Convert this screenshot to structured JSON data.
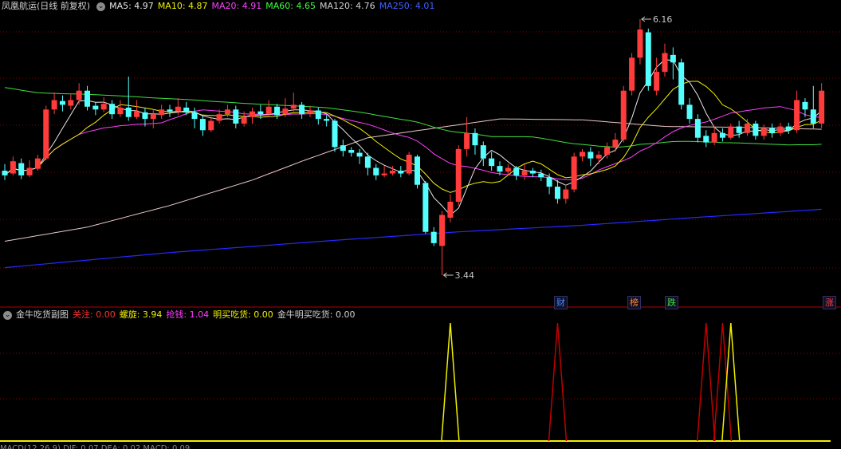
{
  "main_legend": {
    "title": "凤凰航运(日线 前复权)",
    "items": [
      {
        "label": "MA5: 4.97",
        "color": "#e8e8e8"
      },
      {
        "label": "MA10: 4.87",
        "color": "#f0f000"
      },
      {
        "label": "MA20: 4.91",
        "color": "#ff40ff"
      },
      {
        "label": "MA60: 4.65",
        "color": "#40ff40"
      },
      {
        "label": "MA120: 4.76",
        "color": "#d0d0d0"
      },
      {
        "label": "MA250: 4.01",
        "color": "#4060ff"
      }
    ]
  },
  "sub_legend": {
    "title": "金牛吃货副图",
    "items": [
      {
        "label": "关注: 0.00",
        "color": "#ff3030"
      },
      {
        "label": "螺旋: 3.94",
        "color": "#f0f000"
      },
      {
        "label": "抢钱: 1.04",
        "color": "#ff40ff"
      },
      {
        "label": "明买吃货: 0.00",
        "color": "#f0f000"
      },
      {
        "label": "金牛明买吃货: 0.00",
        "color": "#d0d0d0"
      }
    ]
  },
  "annotations": {
    "high": "6.16",
    "low": "3.44"
  },
  "signals": [
    {
      "label": "财",
      "color": "#4a8cff"
    },
    {
      "label": "榜",
      "color": "#ff8a30"
    },
    {
      "label": "跌",
      "color": "#40e040"
    },
    {
      "label": "涨",
      "color": "#ff4040"
    }
  ],
  "colors": {
    "up": "#ff3b3b",
    "down": "#54ffff",
    "grid": "#8b0000",
    "ma5": "#e8e8e8",
    "ma10": "#f0f000",
    "ma20": "#ff40ff",
    "ma60": "#40e040",
    "ma120": "#e8c8c8",
    "ma250": "#2828ff"
  },
  "bottom_strip": "MACD(12,26,9) DIF: 0.07 DEA: 0.02 MACD: 0.09",
  "chart_data": {
    "type": "candlestick",
    "symbol": "凤凰航运",
    "period": "日线 前复权",
    "price_range": [
      3.3,
      6.3
    ],
    "candles": [
      [
        4.55,
        4.5,
        4.62,
        4.45
      ],
      [
        4.52,
        4.65,
        4.7,
        4.5
      ],
      [
        4.63,
        4.5,
        4.68,
        4.46
      ],
      [
        4.5,
        4.58,
        4.66,
        4.48
      ],
      [
        4.57,
        4.68,
        4.72,
        4.55
      ],
      [
        4.68,
        5.2,
        5.24,
        4.66
      ],
      [
        5.2,
        5.3,
        5.38,
        5.15
      ],
      [
        5.29,
        5.25,
        5.35,
        5.18
      ],
      [
        5.24,
        5.3,
        5.36,
        5.2
      ],
      [
        5.3,
        5.4,
        5.48,
        5.25
      ],
      [
        5.4,
        5.23,
        5.45,
        5.19
      ],
      [
        5.24,
        5.2,
        5.28,
        5.14
      ],
      [
        5.2,
        5.26,
        5.33,
        5.17
      ],
      [
        5.26,
        5.15,
        5.3,
        5.1
      ],
      [
        5.15,
        5.22,
        5.3,
        5.12
      ],
      [
        5.22,
        5.12,
        5.55,
        5.08
      ],
      [
        5.12,
        5.18,
        5.3,
        5.1
      ],
      [
        5.17,
        5.1,
        5.22,
        5.02
      ],
      [
        5.1,
        5.15,
        5.2,
        5.0
      ],
      [
        5.14,
        5.2,
        5.25,
        5.1
      ],
      [
        5.2,
        5.18,
        5.25,
        5.12
      ],
      [
        5.18,
        5.23,
        5.32,
        5.14
      ],
      [
        5.22,
        5.17,
        5.28,
        5.14
      ],
      [
        5.17,
        5.1,
        5.22,
        5.0
      ],
      [
        5.1,
        4.98,
        5.14,
        4.92
      ],
      [
        4.98,
        5.08,
        5.12,
        4.96
      ],
      [
        5.08,
        5.15,
        5.2,
        5.05
      ],
      [
        5.15,
        5.2,
        5.25,
        5.12
      ],
      [
        5.2,
        5.05,
        5.24,
        5.0
      ],
      [
        5.05,
        5.12,
        5.18,
        5.02
      ],
      [
        5.12,
        5.18,
        5.22,
        5.05
      ],
      [
        5.18,
        5.15,
        5.25,
        5.1
      ],
      [
        5.15,
        5.23,
        5.3,
        5.12
      ],
      [
        5.23,
        5.14,
        5.26,
        5.1
      ],
      [
        5.15,
        5.21,
        5.32,
        5.12
      ],
      [
        5.21,
        5.25,
        5.38,
        5.18
      ],
      [
        5.25,
        5.15,
        5.28,
        5.1
      ],
      [
        5.16,
        5.19,
        5.24,
        5.12
      ],
      [
        5.19,
        5.1,
        5.22,
        5.04
      ],
      [
        5.1,
        5.08,
        5.14,
        5.02
      ],
      [
        5.08,
        4.8,
        5.1,
        4.75
      ],
      [
        4.82,
        4.76,
        4.88,
        4.7
      ],
      [
        4.77,
        4.74,
        4.8,
        4.7
      ],
      [
        4.74,
        4.7,
        4.78,
        4.62
      ],
      [
        4.7,
        4.58,
        4.74,
        4.5
      ],
      [
        4.58,
        4.5,
        4.62,
        4.45
      ],
      [
        4.5,
        4.52,
        4.6,
        4.48
      ],
      [
        4.52,
        4.55,
        4.6,
        4.5
      ],
      [
        4.55,
        4.52,
        4.6,
        4.48
      ],
      [
        4.52,
        4.72,
        4.75,
        4.5
      ],
      [
        4.7,
        4.4,
        4.72,
        4.36
      ],
      [
        4.42,
        3.9,
        4.44,
        3.88
      ],
      [
        3.9,
        3.78,
        3.95,
        3.75
      ],
      [
        3.75,
        4.08,
        4.12,
        3.44
      ],
      [
        4.05,
        4.22,
        4.3,
        4.0
      ],
      [
        4.22,
        4.78,
        4.82,
        4.18
      ],
      [
        4.78,
        4.95,
        5.12,
        4.7
      ],
      [
        4.95,
        4.82,
        5.0,
        4.72
      ],
      [
        4.82,
        4.68,
        4.86,
        4.6
      ],
      [
        4.68,
        4.6,
        4.75,
        4.55
      ],
      [
        4.6,
        4.54,
        4.65,
        4.5
      ],
      [
        4.54,
        4.58,
        4.62,
        4.5
      ],
      [
        4.58,
        4.5,
        4.6,
        4.45
      ],
      [
        4.5,
        4.55,
        4.62,
        4.45
      ],
      [
        4.55,
        4.52,
        4.58,
        4.48
      ],
      [
        4.52,
        4.48,
        4.56,
        4.44
      ],
      [
        4.48,
        4.38,
        4.52,
        4.3
      ],
      [
        4.38,
        4.25,
        4.45,
        4.2
      ],
      [
        4.25,
        4.35,
        4.4,
        4.2
      ],
      [
        4.35,
        4.7,
        4.74,
        4.32
      ],
      [
        4.7,
        4.75,
        4.78,
        4.65
      ],
      [
        4.75,
        4.68,
        4.8,
        4.6
      ],
      [
        4.68,
        4.72,
        4.76,
        4.62
      ],
      [
        4.72,
        4.8,
        4.85,
        4.68
      ],
      [
        4.8,
        4.88,
        4.95,
        4.75
      ],
      [
        4.88,
        5.4,
        5.45,
        4.85
      ],
      [
        5.4,
        5.75,
        5.8,
        5.35
      ],
      [
        5.75,
        6.05,
        6.16,
        5.68
      ],
      [
        6.02,
        5.45,
        6.06,
        5.4
      ],
      [
        5.4,
        5.6,
        5.75,
        5.35
      ],
      [
        5.6,
        5.8,
        5.9,
        5.55
      ],
      [
        5.78,
        5.7,
        5.86,
        5.52
      ],
      [
        5.7,
        5.25,
        5.74,
        5.2
      ],
      [
        5.25,
        5.1,
        5.32,
        5.05
      ],
      [
        5.1,
        4.9,
        5.15,
        4.85
      ],
      [
        4.92,
        4.85,
        4.98,
        4.8
      ],
      [
        4.85,
        4.95,
        5.02,
        4.82
      ],
      [
        4.95,
        4.9,
        5.0,
        4.86
      ],
      [
        4.9,
        5.02,
        5.05,
        4.88
      ],
      [
        5.02,
        4.95,
        5.08,
        4.9
      ],
      [
        4.95,
        5.05,
        5.1,
        4.92
      ],
      [
        5.05,
        4.92,
        5.08,
        4.88
      ],
      [
        4.92,
        5.0,
        5.04,
        4.88
      ],
      [
        5.0,
        4.95,
        5.05,
        4.9
      ],
      [
        4.95,
        5.02,
        5.06,
        4.92
      ],
      [
        5.02,
        4.98,
        5.06,
        4.94
      ],
      [
        4.98,
        5.3,
        5.4,
        4.95
      ],
      [
        5.28,
        5.2,
        5.32,
        5.12
      ],
      [
        5.2,
        5.05,
        5.45,
        5.0
      ],
      [
        5.05,
        5.4,
        5.48,
        5.0
      ]
    ],
    "ma120": [
      [
        0,
        3.8
      ],
      [
        10,
        3.95
      ],
      [
        20,
        4.18
      ],
      [
        30,
        4.45
      ],
      [
        36,
        4.65
      ],
      [
        44,
        4.9
      ],
      [
        52,
        5.0
      ],
      [
        60,
        5.1
      ],
      [
        70,
        5.09
      ],
      [
        80,
        5.02
      ],
      [
        90,
        5.01
      ],
      [
        99,
        4.99
      ]
    ],
    "ma250": [
      [
        0,
        3.52
      ],
      [
        20,
        3.68
      ],
      [
        40,
        3.81
      ],
      [
        55,
        3.9
      ],
      [
        70,
        3.97
      ],
      [
        85,
        4.06
      ],
      [
        99,
        4.14
      ]
    ],
    "sub_indicator": {
      "name": "金牛吃货副图",
      "yellow_spikes": [
        54,
        88
      ],
      "red_spikes": [
        67,
        85,
        87
      ]
    }
  }
}
